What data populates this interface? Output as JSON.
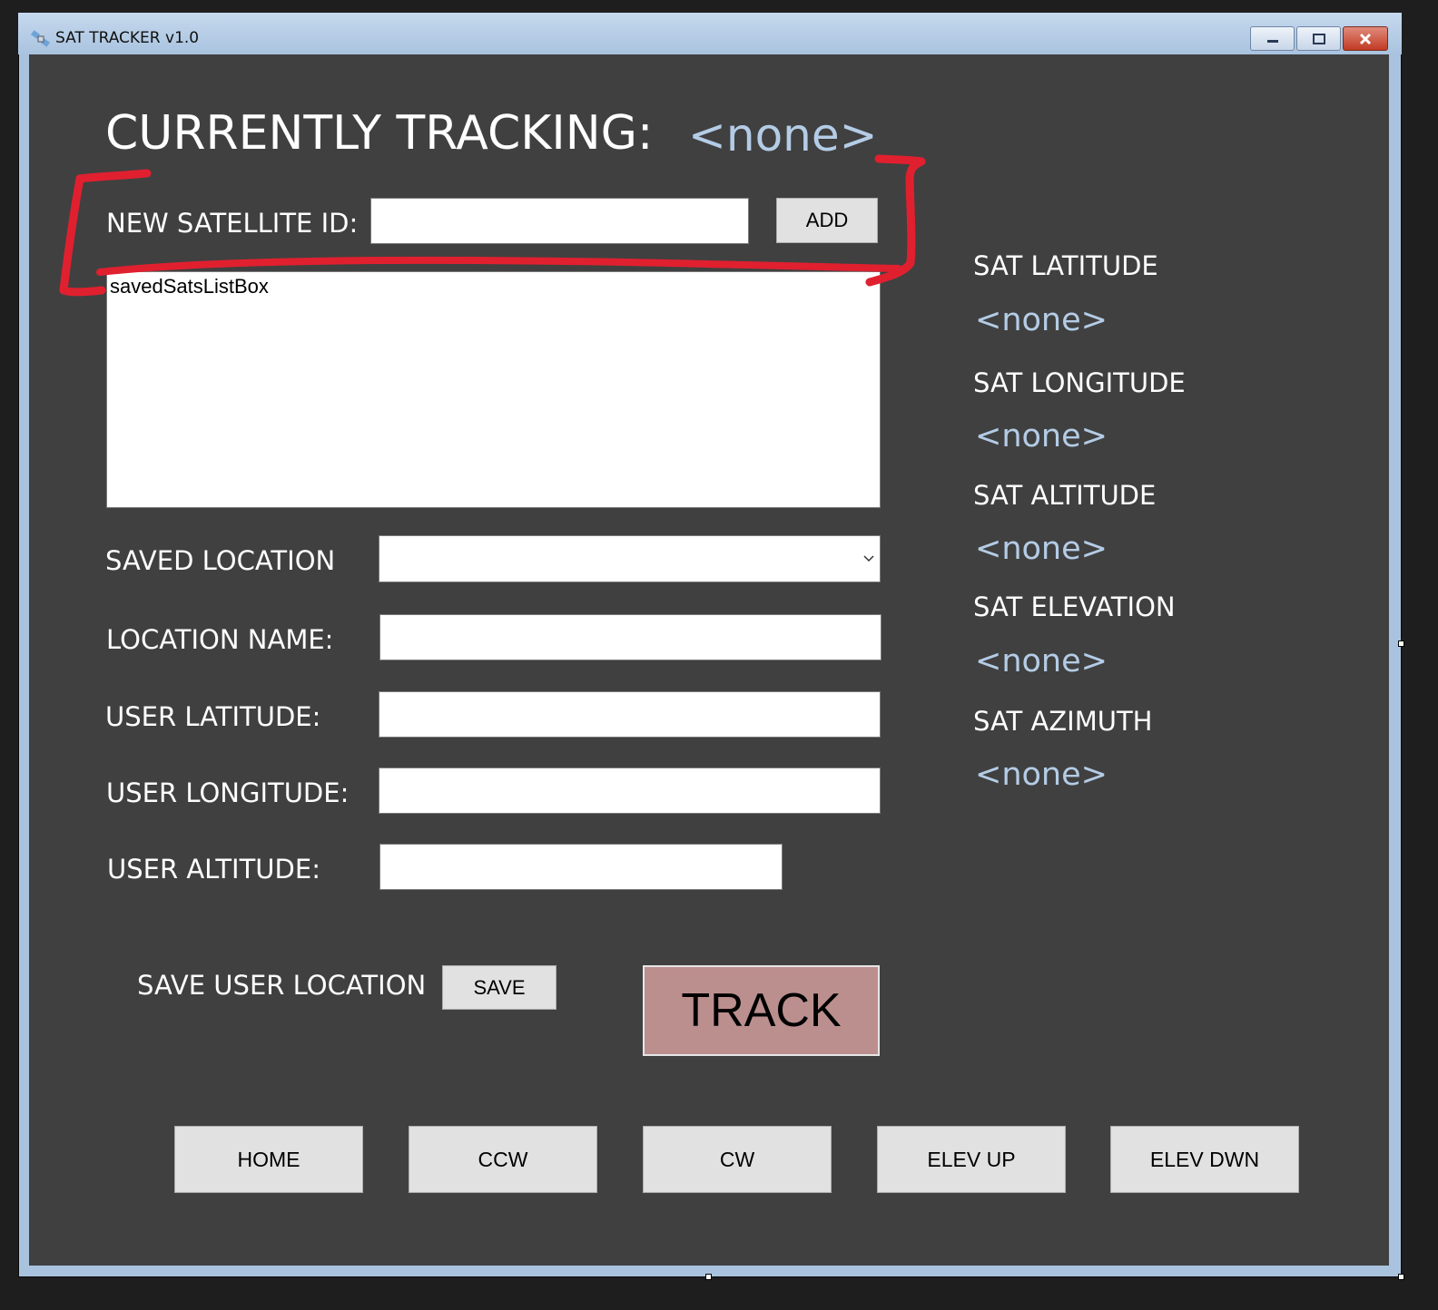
{
  "window": {
    "title": "SAT TRACKER v1.0"
  },
  "tracking": {
    "label": "CURRENTLY TRACKING:",
    "value": "<none>"
  },
  "new_sat": {
    "label": "NEW SATELLITE ID:",
    "value": "",
    "add_label": "ADD"
  },
  "saved_sats": {
    "label": "savedSatsListBox"
  },
  "location": {
    "saved_label": "SAVED LOCATION",
    "saved_value": "",
    "name_label": "LOCATION NAME:",
    "lat_label": "USER LATITUDE:",
    "lon_label": "USER LONGITUDE:",
    "alt_label": "USER ALTITUDE:",
    "save_label": "SAVE USER LOCATION",
    "save_button": "SAVE"
  },
  "track_button": "TRACK",
  "sat_info": [
    {
      "label": "SAT LATITUDE",
      "value": "<none>"
    },
    {
      "label": "SAT LONGITUDE",
      "value": "<none>"
    },
    {
      "label": "SAT ALTITUDE",
      "value": "<none>"
    },
    {
      "label": "SAT ELEVATION",
      "value": "<none>"
    },
    {
      "label": "SAT AZIMUTH",
      "value": "<none>"
    }
  ],
  "controls": [
    "HOME",
    "CCW",
    "CW",
    "ELEV UP",
    "ELEV DWN"
  ],
  "colors": {
    "background": "#404040",
    "value_text": "#b4cce6",
    "track_button": "#bc8f8f",
    "annotation": "#e0202f"
  }
}
